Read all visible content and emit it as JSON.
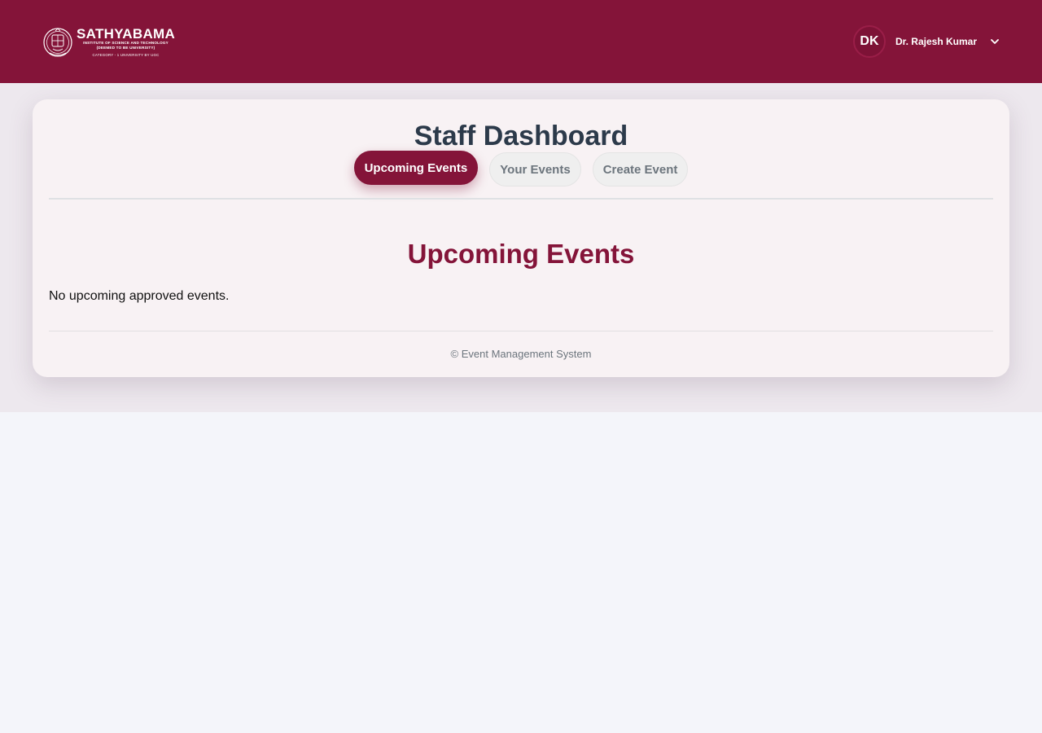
{
  "header": {
    "logo": {
      "name": "SATHYABAMA",
      "line1": "INSTITUTE OF SCIENCE AND TECHNOLOGY",
      "line2": "(DEEMED TO BE UNIVERSITY)",
      "line3": "CATEGORY - 1 UNIVERSITY BY UGC"
    },
    "user": {
      "initials": "DK",
      "name": "Dr. Rajesh Kumar"
    }
  },
  "dashboard": {
    "title": "Staff Dashboard",
    "tabs": [
      {
        "label": "Upcoming Events",
        "active": true
      },
      {
        "label": "Your Events",
        "active": false
      },
      {
        "label": "Create Event",
        "active": false
      }
    ]
  },
  "section": {
    "title": "Upcoming Events",
    "empty_message": "No upcoming approved events."
  },
  "footer": {
    "text": "© Event Management System"
  },
  "colors": {
    "brand": "#841439",
    "title": "#2c3a4a",
    "muted": "#6c757d"
  }
}
